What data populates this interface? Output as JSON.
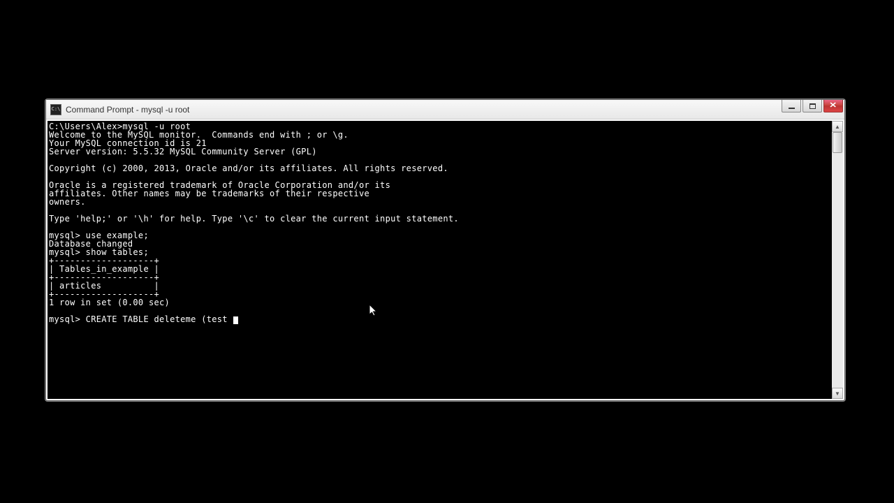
{
  "window": {
    "title": "Command Prompt - mysql  -u root"
  },
  "terminal": {
    "lines": [
      "C:\\Users\\Alex>mysql -u root",
      "Welcome to the MySQL monitor.  Commands end with ; or \\g.",
      "Your MySQL connection id is 21",
      "Server version: 5.5.32 MySQL Community Server (GPL)",
      "",
      "Copyright (c) 2000, 2013, Oracle and/or its affiliates. All rights reserved.",
      "",
      "Oracle is a registered trademark of Oracle Corporation and/or its",
      "affiliates. Other names may be trademarks of their respective",
      "owners.",
      "",
      "Type 'help;' or '\\h' for help. Type '\\c' to clear the current input statement.",
      "",
      "mysql> use example;",
      "Database changed",
      "mysql> show tables;",
      "+-------------------+",
      "| Tables_in_example |",
      "+-------------------+",
      "| articles          |",
      "+-------------------+",
      "1 row in set (0.00 sec)",
      "",
      "mysql> CREATE TABLE deleteme (test "
    ]
  }
}
